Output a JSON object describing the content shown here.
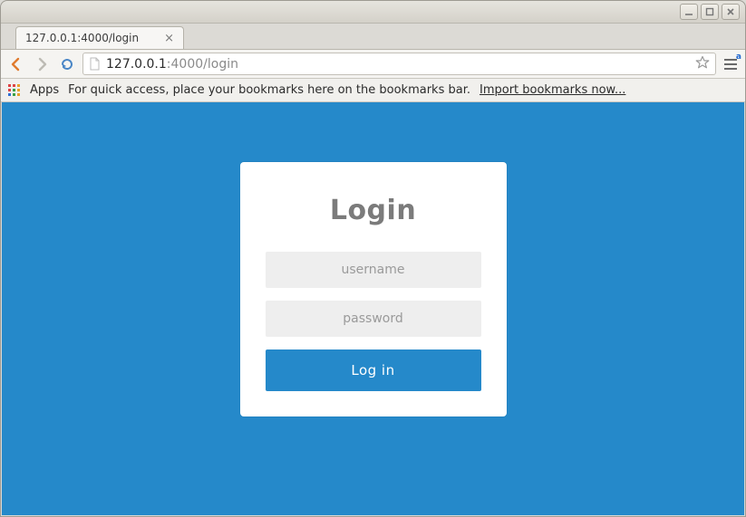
{
  "window": {
    "tab_title": "127.0.0.1:4000/login",
    "url_host": "127.0.0.1",
    "url_rest": ":4000/login",
    "menu_badge": "a"
  },
  "bookmarks_bar": {
    "apps_label": "Apps",
    "hint_text": "For quick access, place your bookmarks here on the bookmarks bar.",
    "import_link": "Import bookmarks now..."
  },
  "login_form": {
    "heading": "Login",
    "username_placeholder": "username",
    "password_placeholder": "password",
    "submit_label": "Log in"
  },
  "colors": {
    "page_bg": "#2589ca",
    "button_bg": "#2589ca",
    "input_bg": "#eeeeee",
    "heading_color": "#7b7b7b"
  }
}
